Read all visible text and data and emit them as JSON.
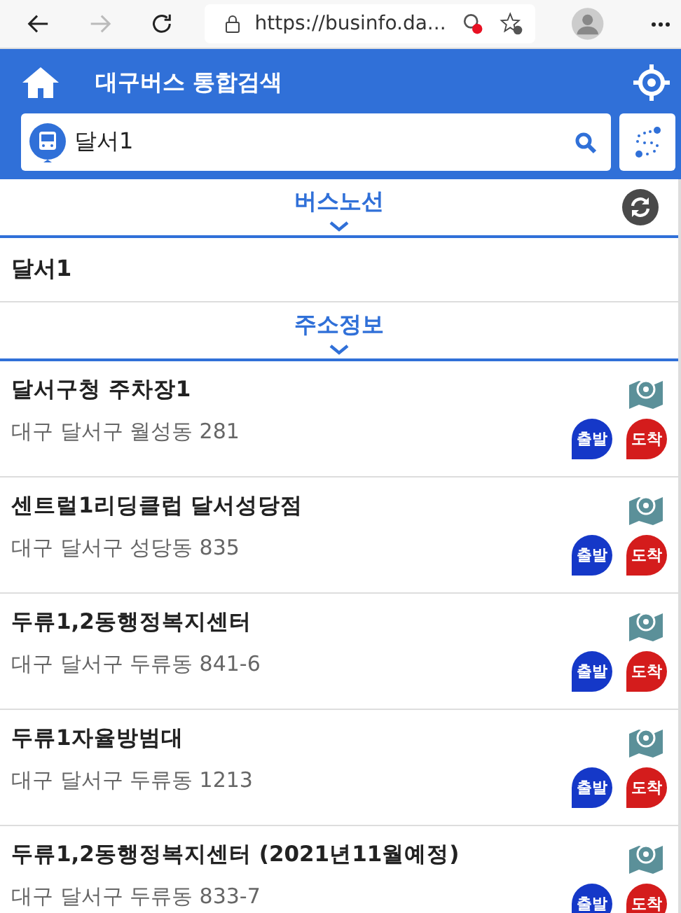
{
  "browser": {
    "url": "https://businfo.da..."
  },
  "header": {
    "title": "대구버스 통합검색"
  },
  "search": {
    "value": "달서1"
  },
  "sections": [
    {
      "title": "버스노선",
      "results": [
        {
          "name": "달서1"
        }
      ]
    },
    {
      "title": "주소정보"
    }
  ],
  "places": [
    {
      "name": "달서구청 주차장1",
      "address": "대구 달서구 월성동 281",
      "depart": "출발",
      "arrive": "도착"
    },
    {
      "name": "센트럴1리딩클럽 달서성당점",
      "address": "대구 달서구 성당동 835",
      "depart": "출발",
      "arrive": "도착"
    },
    {
      "name": "두류1,2동행정복지센터",
      "address": "대구 달서구 두류동 841-6",
      "depart": "출발",
      "arrive": "도착"
    },
    {
      "name": "두류1자율방범대",
      "address": "대구 달서구 두류동 1213",
      "depart": "출발",
      "arrive": "도착"
    },
    {
      "name": "두류1,2동행정복지센터 (2021년11월예정)",
      "address": "대구 달서구 두류동 833-7",
      "depart": "출발",
      "arrive": "도착"
    }
  ]
}
